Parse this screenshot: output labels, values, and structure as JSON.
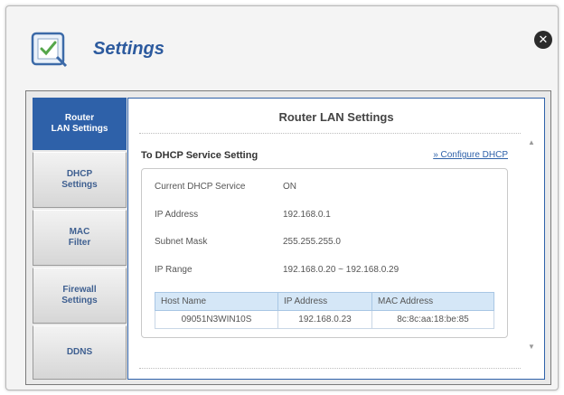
{
  "window": {
    "title": "Settings"
  },
  "sidebar": {
    "items": [
      {
        "label": "Router\nLAN Settings",
        "active": true
      },
      {
        "label": "DHCP\nSettings",
        "active": false
      },
      {
        "label": "MAC\nFilter",
        "active": false
      },
      {
        "label": "Firewall\nSettings",
        "active": false
      },
      {
        "label": "DDNS",
        "active": false
      }
    ]
  },
  "content": {
    "title": "Router LAN Settings",
    "section_title": "To DHCP Service Setting",
    "configure_link": "» Configure DHCP",
    "rows": [
      {
        "label": "Current DHCP Service",
        "value": "ON"
      },
      {
        "label": "IP Address",
        "value": "192.168.0.1"
      },
      {
        "label": "Subnet Mask",
        "value": "255.255.255.0"
      },
      {
        "label": "IP Range",
        "value": "192.168.0.20 ~ 192.168.0.29"
      }
    ],
    "table": {
      "headers": [
        "Host Name",
        "IP Address",
        "MAC Address"
      ],
      "rows": [
        [
          "09051N3WIN10S",
          "192.168.0.23",
          "8c:8c:aa:18:be:85"
        ]
      ]
    }
  },
  "colors": {
    "accent": "#2e61a9",
    "title": "#2c5a9e",
    "table_header": "#d5e7f7"
  },
  "icons": {
    "app": "settings-checklist-icon",
    "close": "close-icon"
  }
}
